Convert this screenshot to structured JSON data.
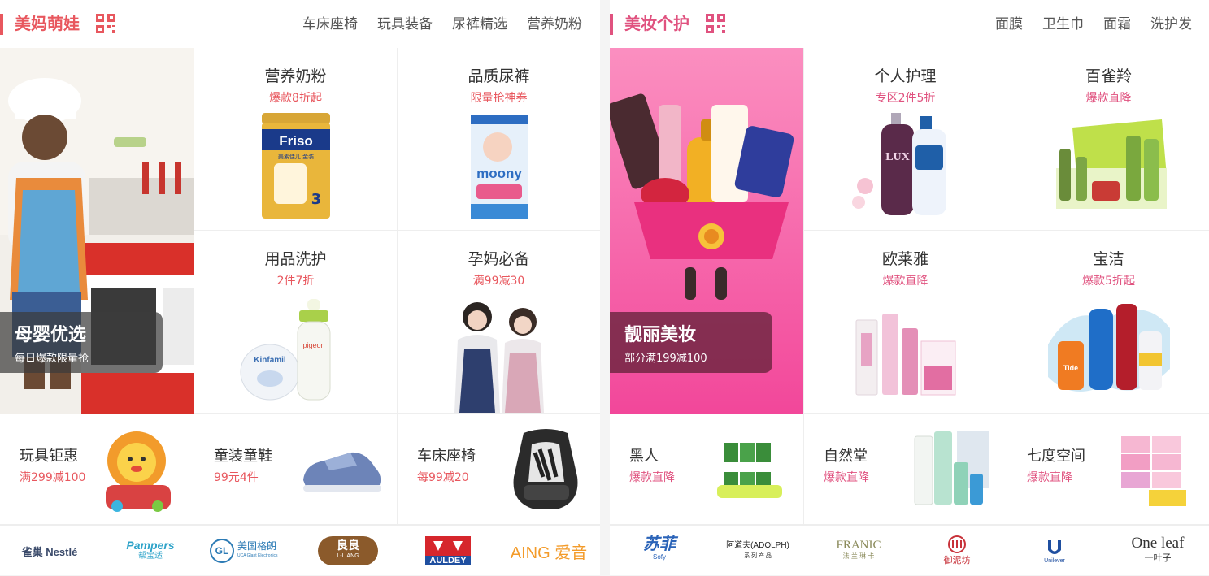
{
  "left_panel": {
    "title": "美妈萌娃",
    "accent": "#e8575e",
    "nav": [
      "车床座椅",
      "玩具装备",
      "尿裤精选",
      "营养奶粉"
    ],
    "hero": {
      "title": "母婴优选",
      "subtitle": "每日爆款限量抢"
    },
    "tiles": [
      {
        "title": "营养奶粉",
        "subtitle": "爆款8折起",
        "product_text": "Friso",
        "product_sub": "美素佳儿 金装",
        "product_num": "3"
      },
      {
        "title": "品质尿裤",
        "subtitle": "限量抢神券",
        "product_text": "moony"
      },
      {
        "title": "用品洗护",
        "subtitle": "2件7折",
        "product_text": "pigeon",
        "product_text2": "Kinfamil"
      },
      {
        "title": "孕妈必备",
        "subtitle": "满99减30"
      }
    ],
    "small_tiles": [
      {
        "title": "玩具钜惠",
        "subtitle": "满299减100"
      },
      {
        "title": "童装童鞋",
        "subtitle": "99元4件"
      },
      {
        "title": "车床座椅",
        "subtitle": "每99减20"
      }
    ],
    "brands": [
      "雀巢 Nestlé",
      "Pampers",
      "帮宝适",
      "美国格朗",
      "GL",
      "UCA Glant Electronics",
      "良良",
      "L-LIANG",
      "AULDEY",
      "AING 爱音"
    ]
  },
  "right_panel": {
    "title": "美妆个护",
    "accent": "#e0527f",
    "nav": [
      "面膜",
      "卫生巾",
      "面霜",
      "洗护发"
    ],
    "hero": {
      "title": "靓丽美妆",
      "subtitle": "部分满199减100"
    },
    "tiles": [
      {
        "title": "个人护理",
        "subtitle": "专区2件5折",
        "product_text": "LUX"
      },
      {
        "title": "百雀羚",
        "subtitle": "爆款直降"
      },
      {
        "title": "欧莱雅",
        "subtitle": "爆款直降"
      },
      {
        "title": "宝洁",
        "subtitle": "爆款5折起",
        "product_text": "Tide"
      }
    ],
    "small_tiles": [
      {
        "title": "黑人",
        "subtitle": "爆款直降"
      },
      {
        "title": "自然堂",
        "subtitle": "爆款直降"
      },
      {
        "title": "七度空间",
        "subtitle": "爆款直降"
      }
    ],
    "brands": [
      "苏菲",
      "Sofy",
      "阿道夫(ADOLPH)",
      "系 列 产 品",
      "FRANIC",
      "法 兰 琳 卡",
      "御泥坊",
      "Unilever",
      "One leaf",
      "一叶子"
    ]
  }
}
